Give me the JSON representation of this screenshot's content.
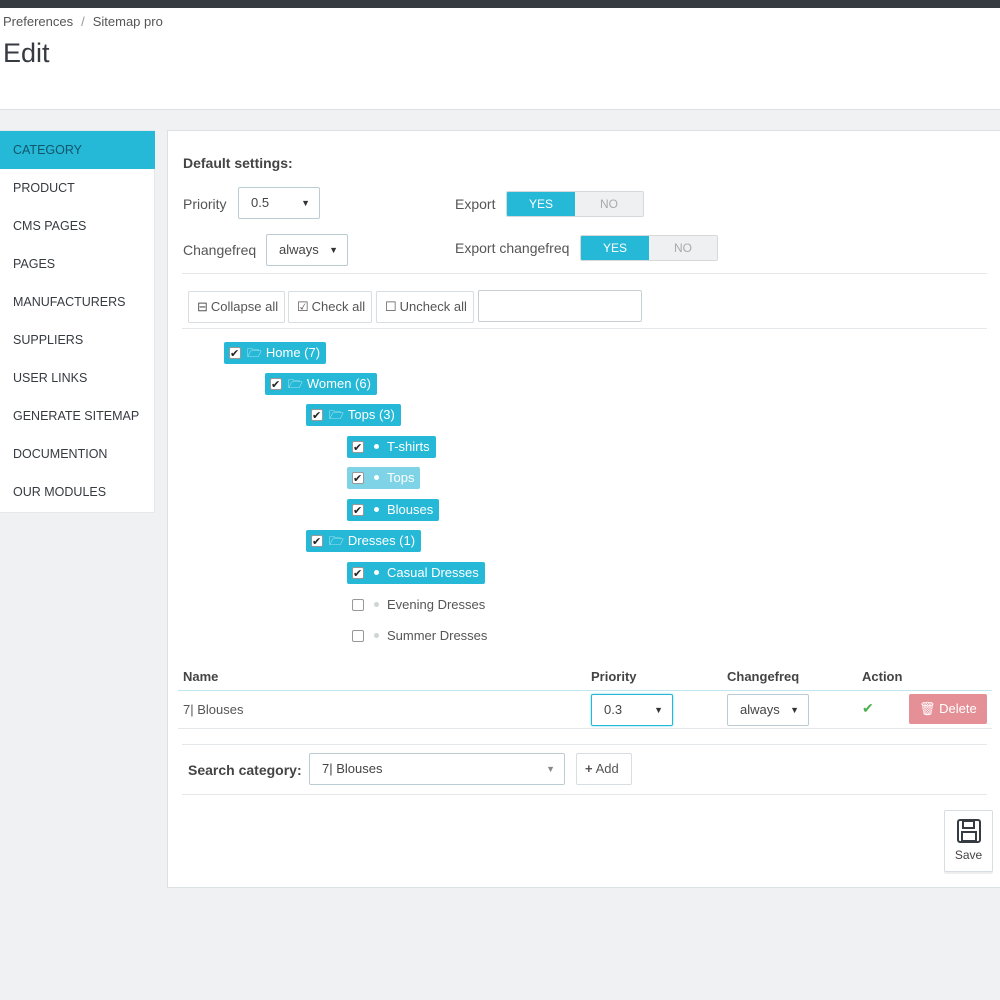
{
  "breadcrumb": [
    "Preferences",
    "Sitemap pro"
  ],
  "page_title": "Edit",
  "sidebar": {
    "items": [
      {
        "label": "CATEGORY",
        "active": true
      },
      {
        "label": "PRODUCT"
      },
      {
        "label": "CMS PAGES"
      },
      {
        "label": "PAGES"
      },
      {
        "label": "MANUFACTURERS"
      },
      {
        "label": "SUPPLIERS"
      },
      {
        "label": "USER LINKS"
      },
      {
        "label": "GENERATE SITEMAP"
      },
      {
        "label": "DOCUMENTION"
      },
      {
        "label": "OUR MODULES"
      }
    ]
  },
  "defaults": {
    "heading": "Default settings:",
    "priority_label": "Priority",
    "priority_value": "0.5",
    "changefreq_label": "Changefreq",
    "changefreq_value": "always",
    "export_label": "Export",
    "export_changefreq_label": "Export changefreq",
    "yes": "YES",
    "no": "NO"
  },
  "tree_toolbar": {
    "collapse": "Collapse all",
    "check": "Check all",
    "uncheck": "Uncheck all",
    "filter_value": ""
  },
  "tree": [
    {
      "label": "Home (7)",
      "type": "folder",
      "checked": true
    },
    {
      "label": "Women (6)",
      "type": "folder",
      "checked": true
    },
    {
      "label": "Tops (3)",
      "type": "folder",
      "checked": true
    },
    {
      "label": "T-shirts",
      "type": "leaf",
      "checked": true
    },
    {
      "label": "Tops",
      "type": "leaf",
      "checked": true,
      "hover": true
    },
    {
      "label": "Blouses",
      "type": "leaf",
      "checked": true
    },
    {
      "label": "Dresses (1)",
      "type": "folder",
      "checked": true
    },
    {
      "label": "Casual Dresses",
      "type": "leaf",
      "checked": true
    },
    {
      "label": "Evening Dresses",
      "type": "leaf",
      "checked": false
    },
    {
      "label": "Summer Dresses",
      "type": "leaf",
      "checked": false
    }
  ],
  "table": {
    "headers": [
      "Name",
      "Priority",
      "Changefreq",
      "Action"
    ],
    "rows": [
      {
        "name": "7| Blouses",
        "priority": "0.3",
        "changefreq": "always",
        "delete_label": "Delete"
      }
    ]
  },
  "search": {
    "label": "Search category:",
    "value": "7| Blouses",
    "add_label": "Add"
  },
  "save_label": "Save",
  "colors": {
    "accent": "#25b9d7",
    "danger": "#e58f97",
    "success": "#4caf50"
  }
}
